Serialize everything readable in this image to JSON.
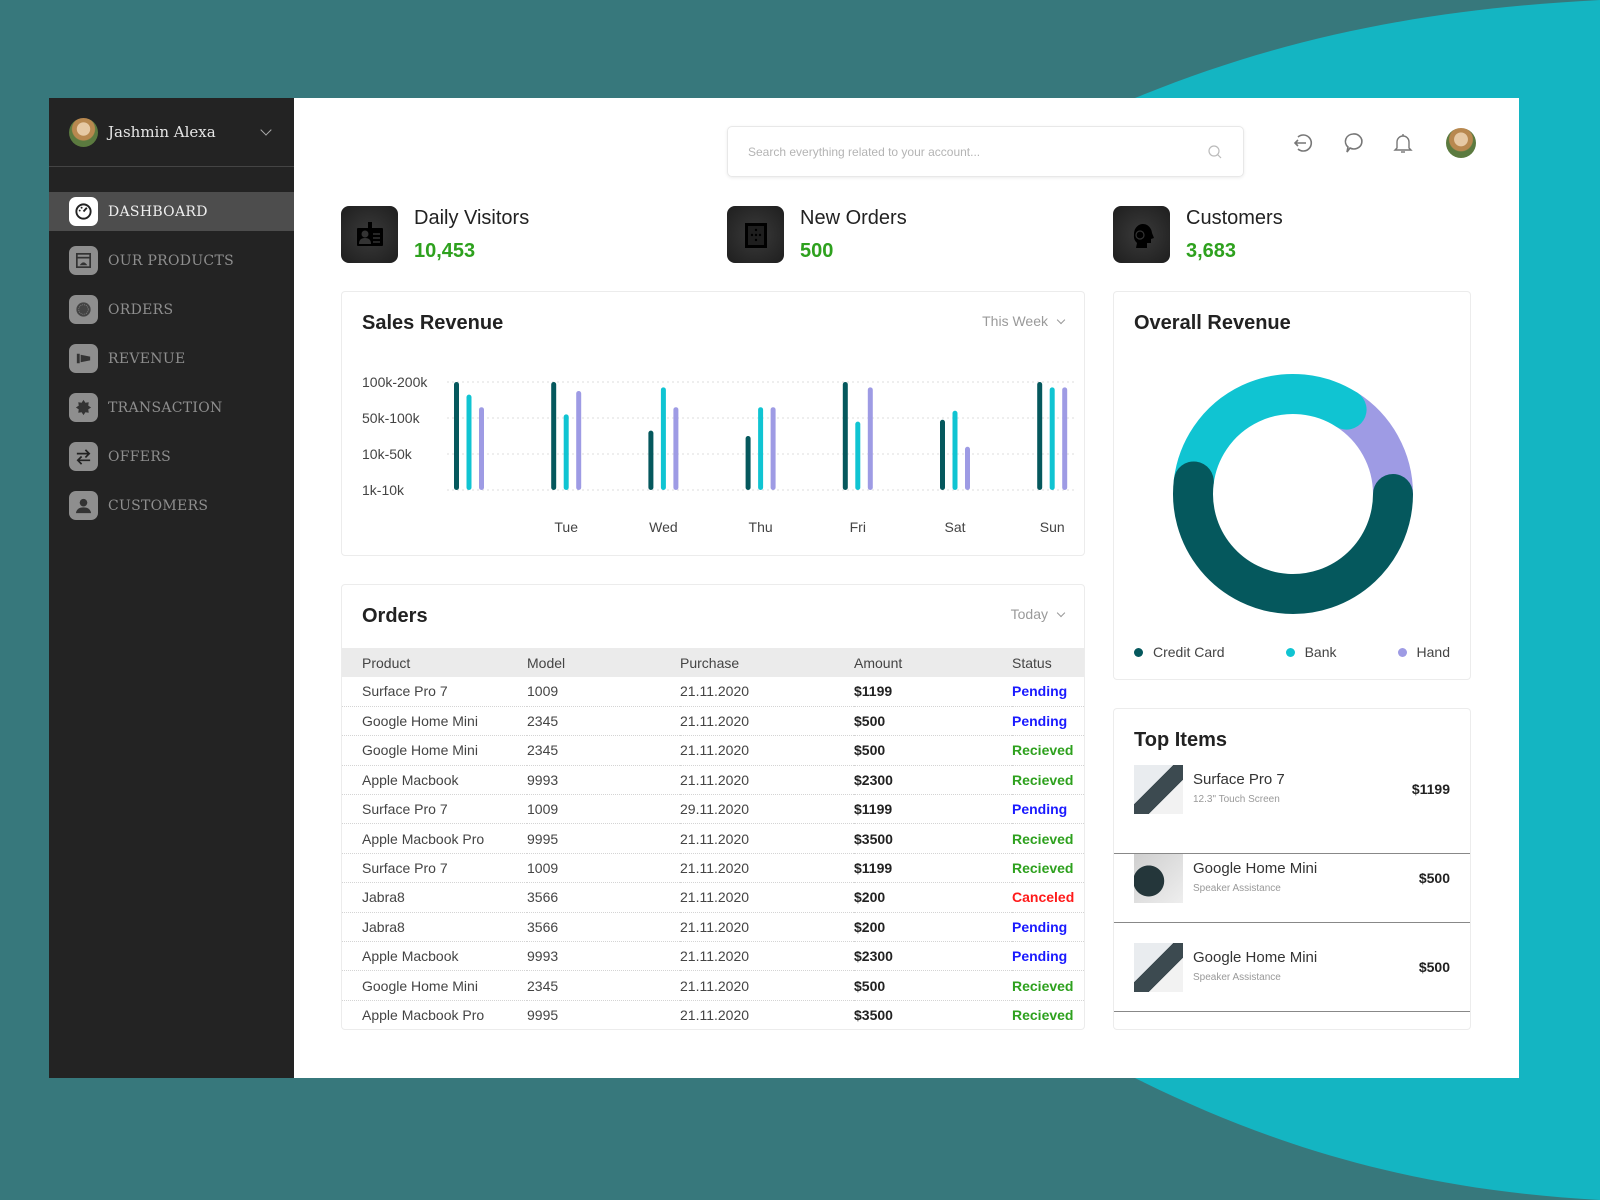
{
  "user": {
    "name": "Jashmin Alexa"
  },
  "sidebar": {
    "items": [
      {
        "label": "DASHBOARD",
        "icon": "speedometer-icon",
        "active": true
      },
      {
        "label": "OUR PRODUCTS",
        "icon": "product-box-icon",
        "active": false
      },
      {
        "label": "ORDERS",
        "icon": "orders-icon",
        "active": false
      },
      {
        "label": "REVENUE",
        "icon": "revenue-icon",
        "active": false
      },
      {
        "label": "TRANSACTION",
        "icon": "sale-badge-icon",
        "active": false
      },
      {
        "label": "OFFERS",
        "icon": "exchange-arrows-icon",
        "active": false
      },
      {
        "label": "CUSTOMERS",
        "icon": "person-icon",
        "active": false
      }
    ]
  },
  "header": {
    "search_placeholder": "Search everything related to your account...",
    "icons": [
      "logout-icon",
      "chat-icon",
      "bell-icon",
      "user-avatar"
    ]
  },
  "stats": [
    {
      "label": "Daily Visitors",
      "value": "10,453",
      "icon": "id-badge-icon"
    },
    {
      "label": "New Orders",
      "value": "500",
      "icon": "order-box-icon"
    },
    {
      "label": "Customers",
      "value": "3,683",
      "icon": "headset-person-icon"
    }
  ],
  "colors": {
    "series_dark": "#05585d",
    "series_cyan": "#10c4d2",
    "series_purple": "#9e9be4",
    "value_green": "#2ea11e",
    "status_pending": "#1a1aff",
    "status_received": "#2ea11e",
    "status_canceled": "#ff1a1a"
  },
  "sales": {
    "title": "Sales Revenue",
    "filter": "This Week"
  },
  "chart_data": [
    {
      "type": "bar",
      "title": "Sales Revenue",
      "y_tick_labels": [
        "100k-200k",
        "50k-100k",
        "10k-50k",
        "1k-10k"
      ],
      "ylim": [
        0,
        3
      ],
      "categories": [
        "",
        "Tue",
        "Wed",
        "Thu",
        "Fri",
        "Sat",
        "Sun"
      ],
      "series": [
        {
          "name": "Credit Card",
          "color": "#05585d",
          "values": [
            3.0,
            3.0,
            1.65,
            1.5,
            3.0,
            1.95,
            3.0
          ]
        },
        {
          "name": "Bank",
          "color": "#10c4d2",
          "values": [
            2.65,
            2.1,
            2.85,
            2.3,
            1.9,
            2.2,
            2.85
          ]
        },
        {
          "name": "Hand",
          "color": "#9e9be4",
          "values": [
            2.3,
            2.75,
            2.3,
            2.3,
            2.85,
            1.2,
            2.85
          ]
        }
      ],
      "grid": true,
      "legend": "none"
    },
    {
      "type": "pie",
      "title": "Overall Revenue",
      "donut": true,
      "slices": [
        {
          "label": "Credit Card",
          "value": 52,
          "color": "#05585d"
        },
        {
          "label": "Bank",
          "value": 32,
          "color": "#10c4d2"
        },
        {
          "label": "Hand",
          "value": 16,
          "color": "#9e9be4"
        }
      ],
      "legend": "bottom"
    }
  ],
  "orders": {
    "title": "Orders",
    "filter": "Today",
    "columns": [
      "Product",
      "Model",
      "Purchase",
      "Amount",
      "Status"
    ],
    "rows": [
      {
        "product": "Surface Pro 7",
        "model": "1009",
        "purchase": "21.11.2020",
        "amount": "$1199",
        "status": "Pending"
      },
      {
        "product": "Google Home Mini",
        "model": "2345",
        "purchase": "21.11.2020",
        "amount": "$500",
        "status": "Pending"
      },
      {
        "product": "Google Home Mini",
        "model": "2345",
        "purchase": "21.11.2020",
        "amount": "$500",
        "status": "Recieved"
      },
      {
        "product": "Apple Macbook",
        "model": "9993",
        "purchase": "21.11.2020",
        "amount": "$2300",
        "status": "Recieved"
      },
      {
        "product": "Surface Pro 7",
        "model": "1009",
        "purchase": "29.11.2020",
        "amount": "$1199",
        "status": "Pending"
      },
      {
        "product": "Apple Macbook Pro",
        "model": "9995",
        "purchase": "21.11.2020",
        "amount": "$3500",
        "status": "Recieved"
      },
      {
        "product": "Surface Pro 7",
        "model": "1009",
        "purchase": "21.11.2020",
        "amount": "$1199",
        "status": "Recieved"
      },
      {
        "product": "Jabra8",
        "model": "3566",
        "purchase": "21.11.2020",
        "amount": "$200",
        "status": "Canceled"
      },
      {
        "product": "Jabra8",
        "model": "3566",
        "purchase": "21.11.2020",
        "amount": "$200",
        "status": "Pending"
      },
      {
        "product": "Apple Macbook",
        "model": "9993",
        "purchase": "21.11.2020",
        "amount": "$2300",
        "status": "Pending"
      },
      {
        "product": "Google Home Mini",
        "model": "2345",
        "purchase": "21.11.2020",
        "amount": "$500",
        "status": "Recieved"
      },
      {
        "product": "Apple Macbook Pro",
        "model": "9995",
        "purchase": "21.11.2020",
        "amount": "$3500",
        "status": "Recieved"
      }
    ]
  },
  "overall_revenue": {
    "title": "Overall Revenue",
    "legend": [
      "Credit Card",
      "Bank",
      "Hand"
    ]
  },
  "top_items": {
    "title": "Top Items",
    "items": [
      {
        "name": "Surface Pro 7",
        "sub": "12.3\" Touch Screen",
        "price": "$1199",
        "thumb": "laptop"
      },
      {
        "name": "Google Home Mini",
        "sub": "Speaker Assistance",
        "price": "$500",
        "thumb": "speaker"
      },
      {
        "name": "Google Home Mini",
        "sub": "Speaker Assistance",
        "price": "$500",
        "thumb": "laptop"
      }
    ]
  }
}
